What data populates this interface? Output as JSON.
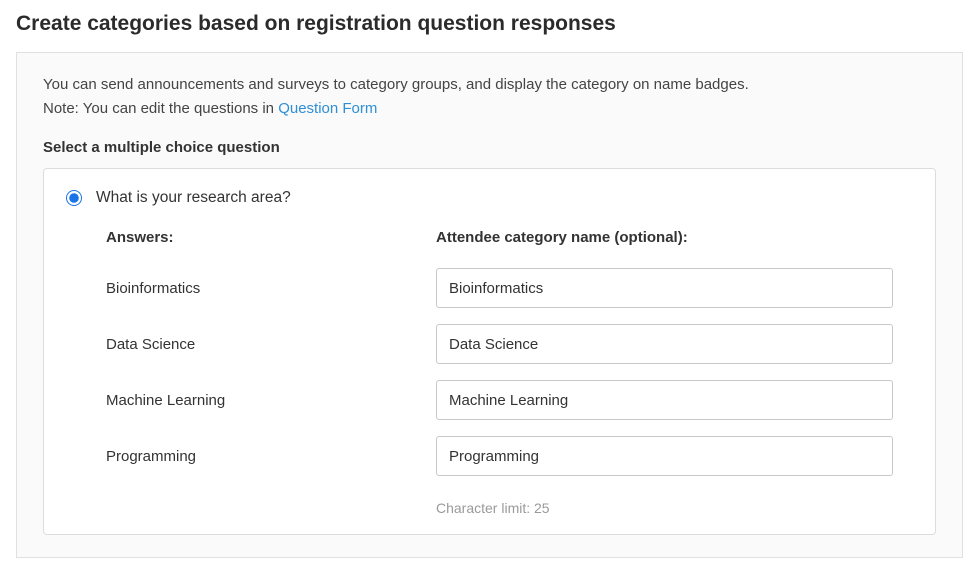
{
  "page": {
    "title": "Create categories based on registration question responses"
  },
  "intro": {
    "line1": "You can send announcements and surveys to category groups, and display the category on name badges.",
    "note_prefix": "Note: You can edit the questions in ",
    "link_text": "Question Form"
  },
  "section": {
    "label": "Select a multiple choice question"
  },
  "question": {
    "text": "What is your research area?",
    "answers_header": "Answers:",
    "category_header": "Attendee category name (optional):",
    "rows": [
      {
        "answer": "Bioinformatics",
        "category": "Bioinformatics"
      },
      {
        "answer": "Data Science",
        "category": "Data Science"
      },
      {
        "answer": "Machine Learning",
        "category": "Machine Learning"
      },
      {
        "answer": "Programming",
        "category": "Programming"
      }
    ],
    "char_limit": "Character limit: 25"
  }
}
